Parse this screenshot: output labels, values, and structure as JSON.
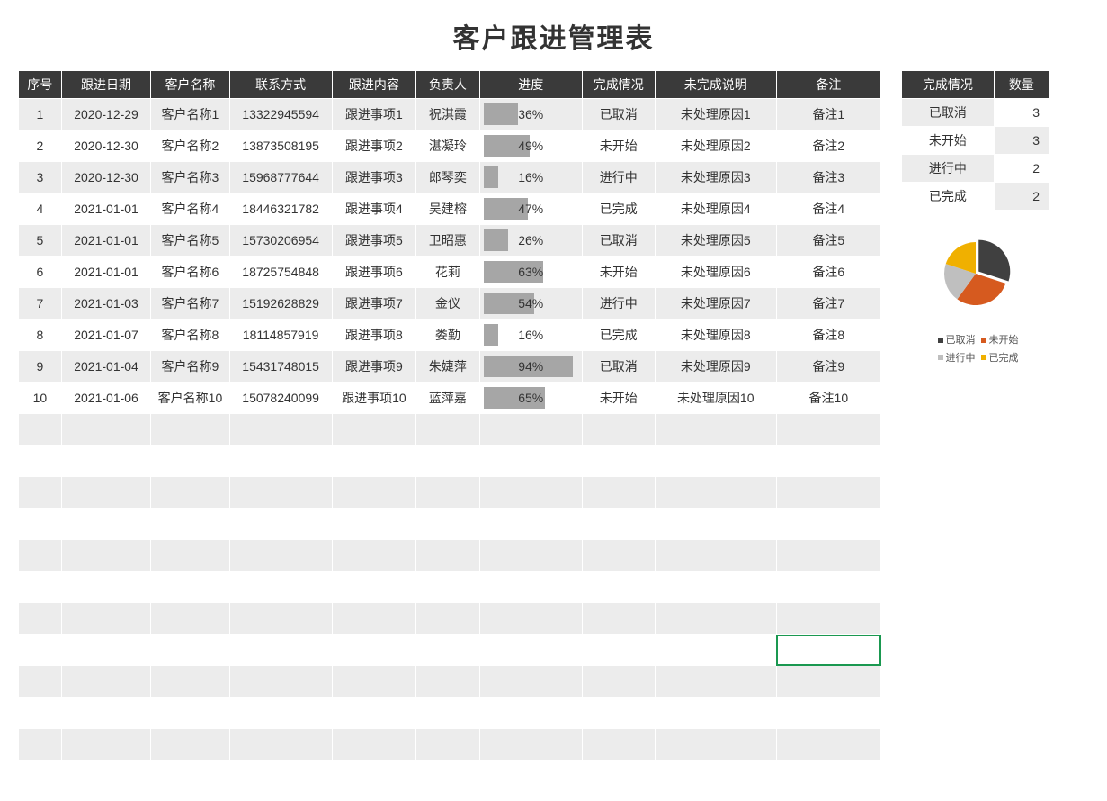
{
  "title": "客户跟进管理表",
  "columns": {
    "seq": "序号",
    "date": "跟进日期",
    "customer": "客户名称",
    "phone": "联系方式",
    "item": "跟进内容",
    "responsible": "负责人",
    "progress": "进度",
    "status": "完成情况",
    "reason": "未完成说明",
    "note": "备注"
  },
  "rows": [
    {
      "seq": "1",
      "date": "2020-12-29",
      "customer": "客户名称1",
      "phone": "13322945594",
      "item": "跟进事项1",
      "responsible": "祝淇霞",
      "progress": 36,
      "status": "已取消",
      "reason": "未处理原因1",
      "note": "备注1"
    },
    {
      "seq": "2",
      "date": "2020-12-30",
      "customer": "客户名称2",
      "phone": "13873508195",
      "item": "跟进事项2",
      "responsible": "湛凝玲",
      "progress": 49,
      "status": "未开始",
      "reason": "未处理原因2",
      "note": "备注2"
    },
    {
      "seq": "3",
      "date": "2020-12-30",
      "customer": "客户名称3",
      "phone": "15968777644",
      "item": "跟进事项3",
      "responsible": "郎琴奕",
      "progress": 16,
      "status": "进行中",
      "reason": "未处理原因3",
      "note": "备注3"
    },
    {
      "seq": "4",
      "date": "2021-01-01",
      "customer": "客户名称4",
      "phone": "18446321782",
      "item": "跟进事项4",
      "responsible": "吴建榕",
      "progress": 47,
      "status": "已完成",
      "reason": "未处理原因4",
      "note": "备注4"
    },
    {
      "seq": "5",
      "date": "2021-01-01",
      "customer": "客户名称5",
      "phone": "15730206954",
      "item": "跟进事项5",
      "responsible": "卫昭惠",
      "progress": 26,
      "status": "已取消",
      "reason": "未处理原因5",
      "note": "备注5"
    },
    {
      "seq": "6",
      "date": "2021-01-01",
      "customer": "客户名称6",
      "phone": "18725754848",
      "item": "跟进事项6",
      "responsible": "花莉",
      "progress": 63,
      "status": "未开始",
      "reason": "未处理原因6",
      "note": "备注6"
    },
    {
      "seq": "7",
      "date": "2021-01-03",
      "customer": "客户名称7",
      "phone": "15192628829",
      "item": "跟进事项7",
      "responsible": "金仪",
      "progress": 54,
      "status": "进行中",
      "reason": "未处理原因7",
      "note": "备注7"
    },
    {
      "seq": "8",
      "date": "2021-01-07",
      "customer": "客户名称8",
      "phone": "18114857919",
      "item": "跟进事项8",
      "responsible": "娄勤",
      "progress": 16,
      "status": "已完成",
      "reason": "未处理原因8",
      "note": "备注8"
    },
    {
      "seq": "9",
      "date": "2021-01-04",
      "customer": "客户名称9",
      "phone": "15431748015",
      "item": "跟进事项9",
      "responsible": "朱婕萍",
      "progress": 94,
      "status": "已取消",
      "reason": "未处理原因9",
      "note": "备注9"
    },
    {
      "seq": "10",
      "date": "2021-01-06",
      "customer": "客户名称10",
      "phone": "15078240099",
      "item": "跟进事项10",
      "responsible": "蓝萍嘉",
      "progress": 65,
      "status": "未开始",
      "reason": "未处理原因10",
      "note": "备注10"
    }
  ],
  "blank_rows": 12,
  "selected_cell": {
    "row_index": 17,
    "col_index": 9
  },
  "summary": {
    "columns": {
      "status": "完成情况",
      "count": "数量"
    },
    "rows": [
      {
        "status": "已取消",
        "count": 3
      },
      {
        "status": "未开始",
        "count": 3
      },
      {
        "status": "进行中",
        "count": 2
      },
      {
        "status": "已完成",
        "count": 2
      }
    ]
  },
  "chart_data": {
    "type": "pie",
    "title": "",
    "series": [
      {
        "name": "已取消",
        "value": 3,
        "color": "#404040"
      },
      {
        "name": "未开始",
        "value": 3,
        "color": "#d65a1f"
      },
      {
        "name": "进行中",
        "value": 2,
        "color": "#bfbfbf"
      },
      {
        "name": "已完成",
        "value": 2,
        "color": "#f0b过00"
      }
    ],
    "colors": [
      "#404040",
      "#d65a1f",
      "#bfbfbf",
      "#f0b000"
    ],
    "legend_labels": [
      "已取消",
      "未开始",
      "进行中",
      "已完成"
    ]
  }
}
